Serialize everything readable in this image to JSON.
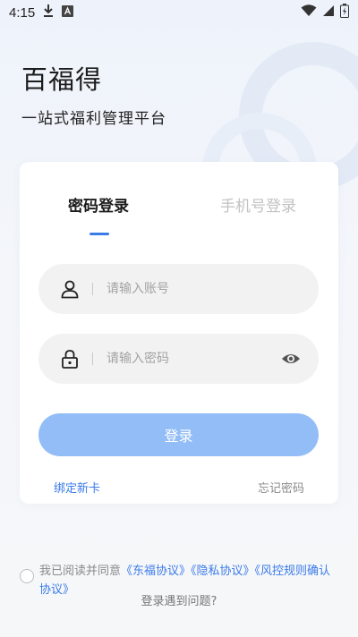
{
  "status_bar": {
    "time": "4:15",
    "icons": [
      "download-icon",
      "notification-a-icon",
      "wifi-icon",
      "signal-icon",
      "battery-icon"
    ]
  },
  "brand": {
    "title": "百福得",
    "subtitle": "一站式福利管理平台"
  },
  "tabs": [
    {
      "label": "密码登录",
      "active": true
    },
    {
      "label": "手机号登录",
      "active": false
    }
  ],
  "form": {
    "account_placeholder": "请输入账号",
    "account_value": "",
    "password_placeholder": "请输入密码",
    "password_value": ""
  },
  "login_button": {
    "label": "登录"
  },
  "links": {
    "bind_card": "绑定新卡",
    "forgot_password": "忘记密码"
  },
  "agreement": {
    "checked": false,
    "prefix": "我已阅读并同意",
    "links": [
      "《东福协议》",
      "《隐私协议》",
      "《风控规则确认协议》"
    ]
  },
  "help": {
    "label": "登录遇到问题?"
  },
  "colors": {
    "accent": "#3a7be8",
    "button_disabled": "#93bdf7",
    "field_bg": "#f2f2f2"
  }
}
